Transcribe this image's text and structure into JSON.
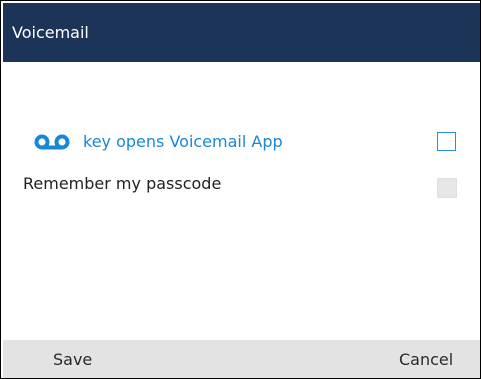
{
  "header": {
    "title": "Voicemail"
  },
  "options": [
    {
      "label": "key opens Voicemail App",
      "checked": false,
      "icon": "voicemail-icon",
      "accent": "#1a87d6"
    },
    {
      "label": "Remember my passcode",
      "checked": false,
      "disabled": true
    }
  ],
  "softkeys": {
    "save": "Save",
    "cancel": "Cancel"
  },
  "colors": {
    "header_bg": "#1c3458",
    "accent": "#1a87d6",
    "footer_bg": "#e3e3e3"
  }
}
